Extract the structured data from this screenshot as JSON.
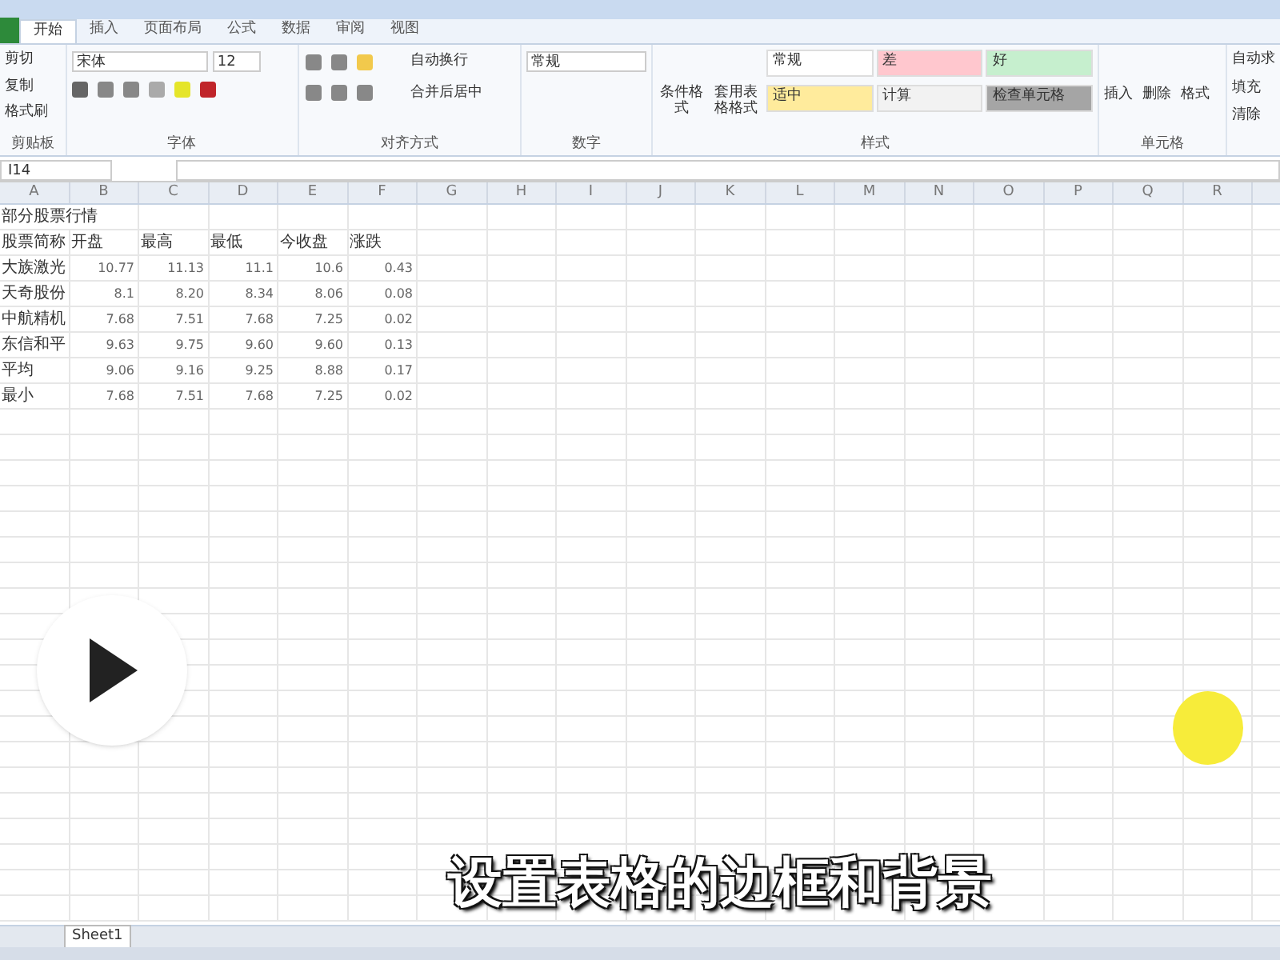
{
  "ribbon": {
    "tabs": [
      {
        "label": "开始",
        "selected": true
      },
      {
        "label": "插入",
        "selected": false
      },
      {
        "label": "页面布局",
        "selected": false
      },
      {
        "label": "公式",
        "selected": false
      },
      {
        "label": "数据",
        "selected": false
      },
      {
        "label": "审阅",
        "selected": false
      },
      {
        "label": "视图",
        "selected": false
      }
    ],
    "clipboard": {
      "items": [
        "剪切",
        "复制",
        "格式刷"
      ],
      "label": "剪贴板"
    },
    "font": {
      "name": "宋体",
      "size": "12",
      "label": "字体"
    },
    "alignment": {
      "wrap": "自动换行",
      "merge": "合并后居中",
      "label": "对齐方式"
    },
    "number": {
      "format": "常规",
      "label": "数字"
    },
    "styles": {
      "buttons": [
        "条件格式",
        "套用表格格式"
      ],
      "cells": [
        {
          "label": "常规",
          "color": "#ffffff"
        },
        {
          "label": "差",
          "color": "#ffc7ce"
        },
        {
          "label": "好",
          "color": "#c6efce"
        },
        {
          "label": "适中",
          "color": "#ffeb9c"
        },
        {
          "label": "计算",
          "color": "#f2f2f2"
        },
        {
          "label": "检查单元格",
          "color": "#a5a5a5"
        }
      ],
      "label": "样式"
    },
    "cells": {
      "buttons": [
        "插入",
        "删除",
        "格式"
      ],
      "label": "单元格"
    },
    "editing": [
      "自动求",
      "填充",
      "清除"
    ]
  },
  "formula_bar": {
    "name_box": "I14"
  },
  "sheet": {
    "columns": [
      "A",
      "B",
      "C",
      "D",
      "E",
      "F",
      "G",
      "H",
      "I",
      "J",
      "K",
      "L",
      "M",
      "N",
      "O",
      "P",
      "Q",
      "R"
    ],
    "rows": [
      [
        "部分股票行情"
      ],
      [
        "股票简称",
        "开盘",
        "最高",
        "最低",
        "今收盘",
        "涨跌"
      ],
      [
        "大族激光",
        "10.77",
        "11.13",
        "11.1",
        "10.6",
        "0.43"
      ],
      [
        "天奇股份",
        "8.1",
        "8.20",
        "8.34",
        "8.06",
        "0.08"
      ],
      [
        "中航精机",
        "7.68",
        "7.51",
        "7.68",
        "7.25",
        "0.02"
      ],
      [
        "东信和平",
        "9.63",
        "9.75",
        "9.60",
        "9.60",
        "0.13"
      ],
      [
        "平均",
        "9.06",
        "9.16",
        "9.25",
        "8.88",
        "0.17"
      ],
      [
        "最小",
        "7.68",
        "7.51",
        "7.68",
        "7.25",
        "0.02"
      ]
    ]
  },
  "sheet_tabs": [
    {
      "label": "Sheet1",
      "selected": true
    }
  ],
  "subtitle": "设置表格的边框和背景"
}
